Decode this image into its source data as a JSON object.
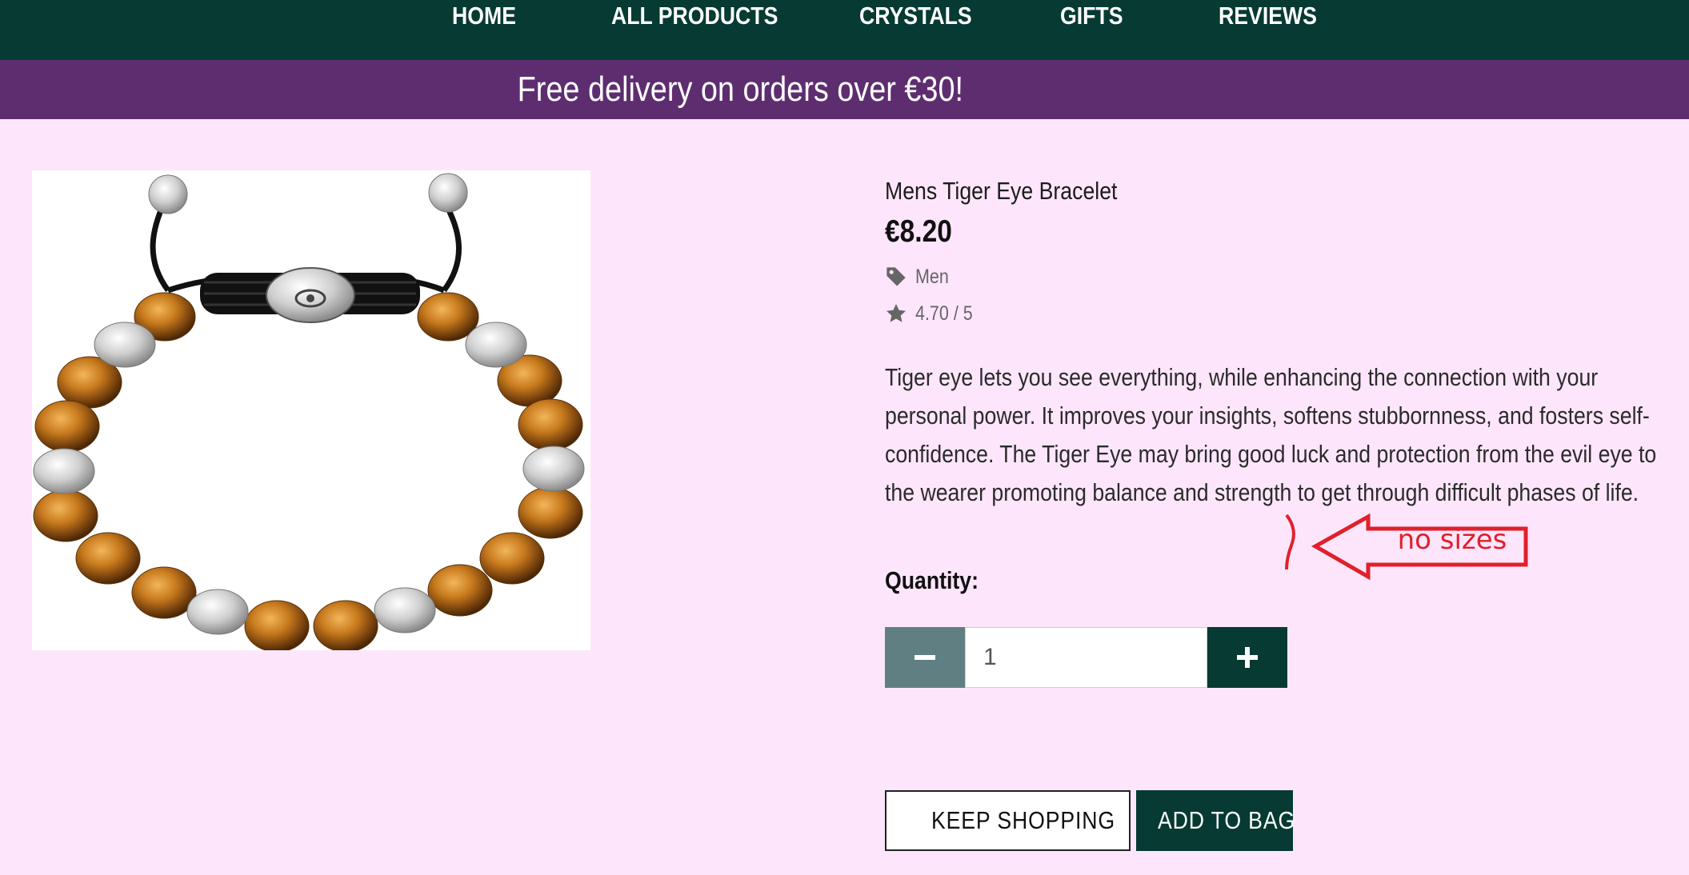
{
  "nav": {
    "items": [
      {
        "label": "HOME"
      },
      {
        "label": "ALL PRODUCTS"
      },
      {
        "label": "CRYSTALS"
      },
      {
        "label": "GIFTS"
      },
      {
        "label": "REVIEWS"
      }
    ]
  },
  "banner": {
    "text": "Free delivery on orders over €30!"
  },
  "product": {
    "name": "Mens Tiger Eye Bracelet",
    "price": "€8.20",
    "category": "Men",
    "rating": "4.70 / 5",
    "description": "Tiger eye lets you see everything, while enhancing the connection with your personal power. It improves your insights, softens stubbornness, and fosters self-confidence. The Tiger Eye may bring good luck and protection from the evil eye to the wearer promoting balance and strength to get through difficult phases of life.",
    "image_icon": "bracelet-image"
  },
  "quantity": {
    "label": "Quantity:",
    "value": "1",
    "decrement_icon": "minus-icon",
    "increment_icon": "plus-icon"
  },
  "actions": {
    "keep_shopping_label": "KEEP SHOPPING",
    "keep_shopping_icon": "chevron-left-icon",
    "add_to_bag_label": "ADD TO BAG"
  },
  "annotation": {
    "text": "no sizes",
    "icon": "arrow-left-icon",
    "color": "#e0202b"
  },
  "colors": {
    "nav_bg": "#063a33",
    "banner_bg": "#5e2d70",
    "page_bg": "#fde6fb",
    "decrement_bg": "#5f7f83",
    "increment_bg": "#063a33"
  }
}
